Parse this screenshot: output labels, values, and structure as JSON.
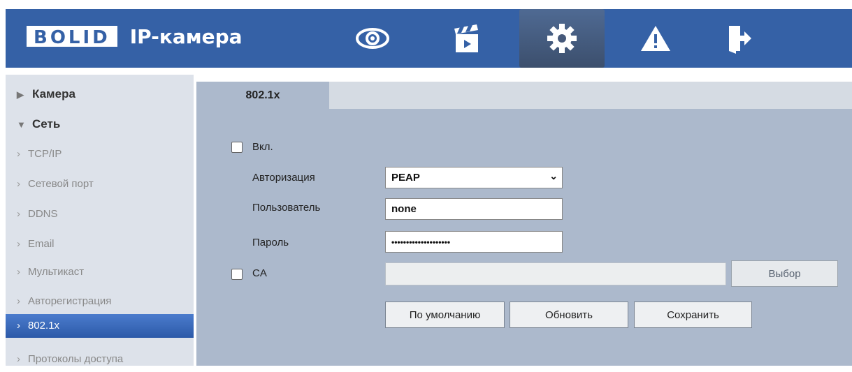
{
  "header": {
    "logo_brand": "BOLID",
    "logo_text": "IP-камера",
    "nav": [
      {
        "icon": "eye-icon"
      },
      {
        "icon": "clapperboard-icon"
      },
      {
        "icon": "gear-icon"
      },
      {
        "icon": "warning-icon"
      },
      {
        "icon": "logout-icon"
      }
    ],
    "accent": "#3561a6"
  },
  "sidebar": {
    "items": [
      {
        "label": "Камера"
      },
      {
        "label": "Сеть"
      },
      {
        "label": "TCP/IP"
      },
      {
        "label": "Сетевой порт"
      },
      {
        "label": "DDNS"
      },
      {
        "label": "Email"
      },
      {
        "label": "Мультикаст"
      },
      {
        "label": "Авторегистрация"
      },
      {
        "label": "802.1x"
      },
      {
        "label": "Протоколы доступа"
      }
    ],
    "selected": "802.1x"
  },
  "tab": {
    "label": "802.1x"
  },
  "form": {
    "enable_label": "Вкл.",
    "auth_label": "Авторизация",
    "auth_value": "PEAP",
    "user_label": "Пользователь",
    "user_value": "none",
    "password_label": "Пароль",
    "password_value": "••••••••••••••••••••",
    "ca_label": "CA",
    "ca_value": "",
    "browse_label": "Выбор",
    "default_label": "По умолчанию",
    "refresh_label": "Обновить",
    "save_label": "Сохранить"
  }
}
